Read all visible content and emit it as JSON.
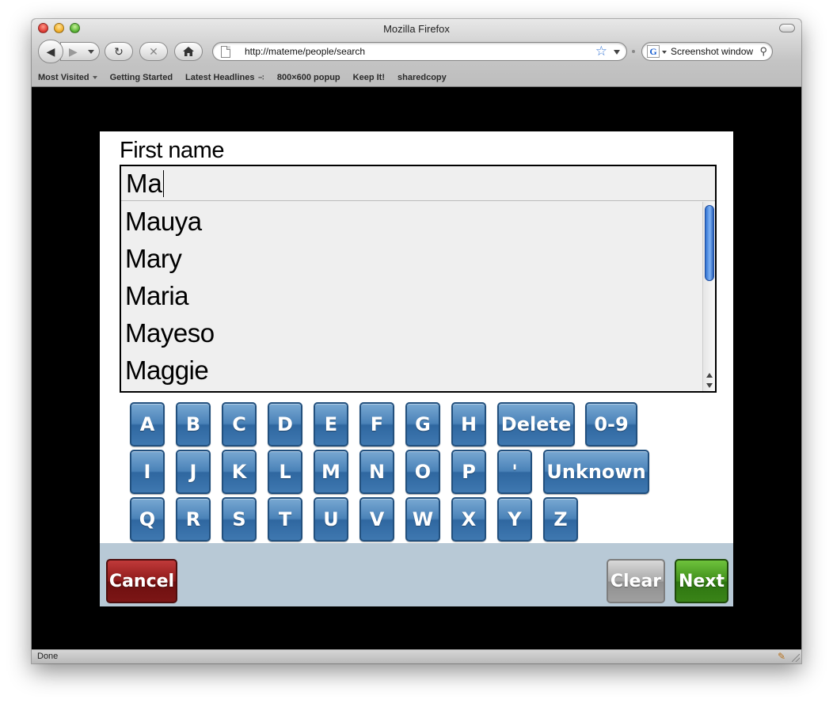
{
  "window": {
    "title": "Mozilla Firefox"
  },
  "navbar": {
    "url": "http://mateme/people/search",
    "search_value": "Screenshot window",
    "search_engine": "G"
  },
  "bookmarks": [
    {
      "label": "Most Visited",
      "has_menu": true
    },
    {
      "label": "Getting Started"
    },
    {
      "label": "Latest Headlines",
      "rss": true
    },
    {
      "label": "800×600 popup"
    },
    {
      "label": "Keep It!"
    },
    {
      "label": "sharedcopy"
    }
  ],
  "form": {
    "label": "First name",
    "input_value": "Ma",
    "suggestions": [
      "Mauya",
      "Mary",
      "Maria",
      "Mayeso",
      "Maggie"
    ]
  },
  "keyboard": {
    "row1": [
      "A",
      "B",
      "C",
      "D",
      "E",
      "F",
      "G",
      "H",
      "Delete",
      "0-9"
    ],
    "row2": [
      "I",
      "J",
      "K",
      "L",
      "M",
      "N",
      "O",
      "P",
      "'",
      "Unknown"
    ],
    "row3": [
      "Q",
      "R",
      "S",
      "T",
      "U",
      "V",
      "W",
      "X",
      "Y",
      "Z"
    ]
  },
  "footer": {
    "cancel": "Cancel",
    "clear": "Clear",
    "next": "Next"
  },
  "status": {
    "text": "Done"
  },
  "colors": {
    "key_blue": "#3f78b0",
    "cancel_red": "#8e1a1a",
    "next_green": "#3f8e1a",
    "clear_gray": "#a0a0a0",
    "footer_bg": "#b8c9d6"
  },
  "icons": [
    "back-icon",
    "forward-icon",
    "reload-icon",
    "stop-icon",
    "home-icon",
    "page-icon",
    "bookmark-star-icon",
    "search-icon",
    "rss-icon",
    "addon-icon"
  ]
}
